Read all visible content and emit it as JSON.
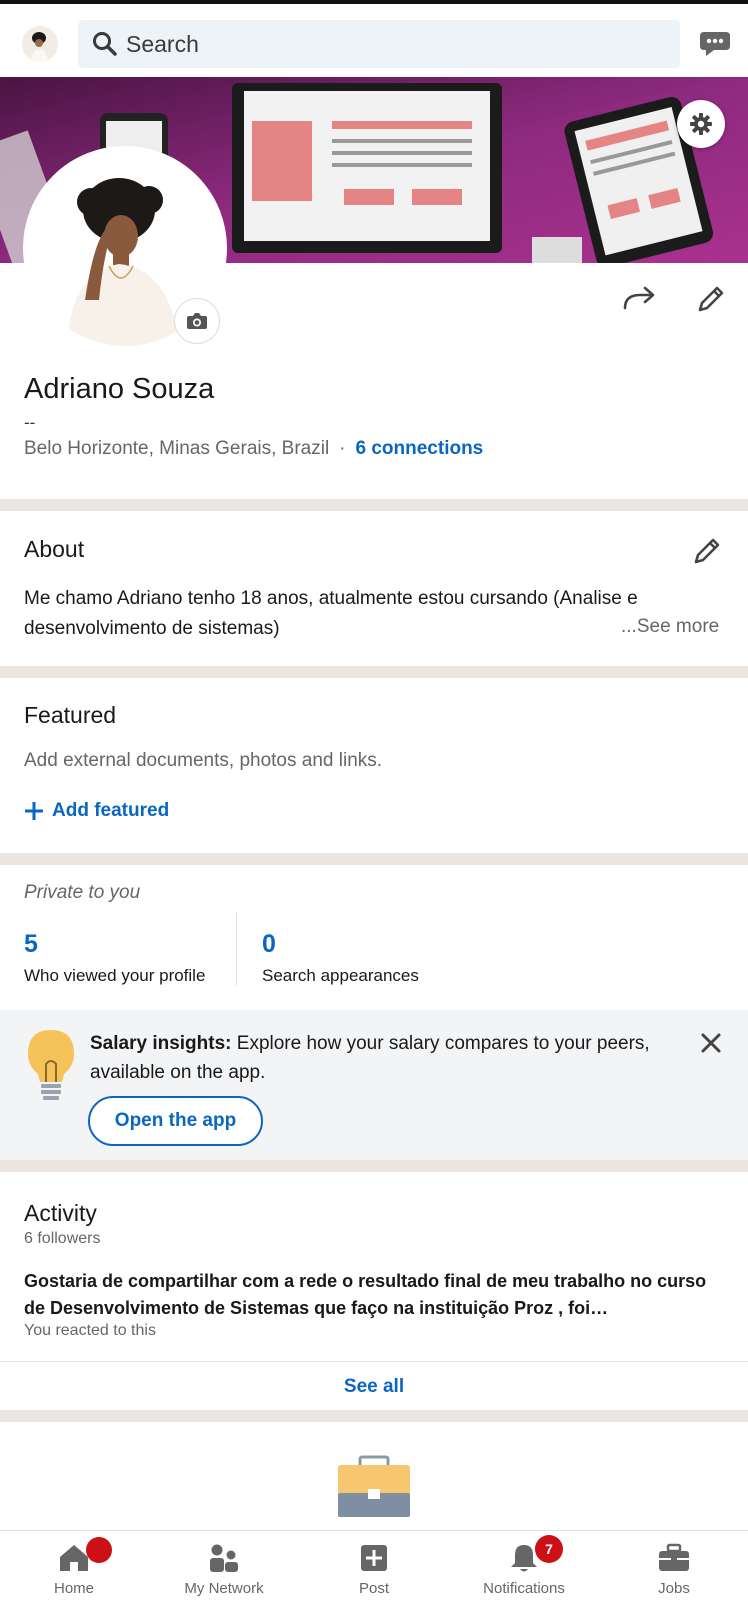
{
  "header": {
    "search_placeholder": "Search",
    "icons": [
      "user-avatar",
      "search-icon",
      "messaging-icon"
    ]
  },
  "profile": {
    "name": "Adriano Souza",
    "headline": "--",
    "location": "Belo Horizonte, Minas Gerais, Brazil",
    "separator": "·",
    "connections": "6 connections"
  },
  "about": {
    "title": "About",
    "text": "Me chamo Adriano tenho 18 anos, atualmente estou cursando (Analise e desenvolvimento de sistemas)",
    "see_more": "...See more"
  },
  "featured": {
    "title": "Featured",
    "description": "Add external documents, photos and links.",
    "add_label": "Add featured"
  },
  "analytics": {
    "private_label": "Private to you",
    "stats": [
      {
        "value": "5",
        "label": "Who viewed your profile"
      },
      {
        "value": "0",
        "label": "Search appearances"
      }
    ]
  },
  "salary_insights": {
    "title": "Salary insights:",
    "text": " Explore how your salary compares to your peers, available on the app.",
    "button": "Open the app"
  },
  "activity": {
    "title": "Activity",
    "followers": "6 followers",
    "post_text": "Gostaria de compartilhar com a rede o resultado final de meu trabalho no curso de Desenvolvimento de Sistemas que faço na instituição Proz , foi…",
    "post_meta": "You reacted to this",
    "see_all": "See all"
  },
  "bottom_nav": {
    "items": [
      {
        "label": "Home",
        "icon": "home-icon"
      },
      {
        "label": "My Network",
        "icon": "network-icon"
      },
      {
        "label": "Post",
        "icon": "post-icon"
      },
      {
        "label": "Notifications",
        "icon": "bell-icon",
        "badge": "7"
      },
      {
        "label": "Jobs",
        "icon": "briefcase-icon"
      }
    ]
  },
  "colors": {
    "accent": "#0a66c2",
    "badge": "#cc1016",
    "divider": "#ebe6e1",
    "banner": "#7a1e6e"
  }
}
